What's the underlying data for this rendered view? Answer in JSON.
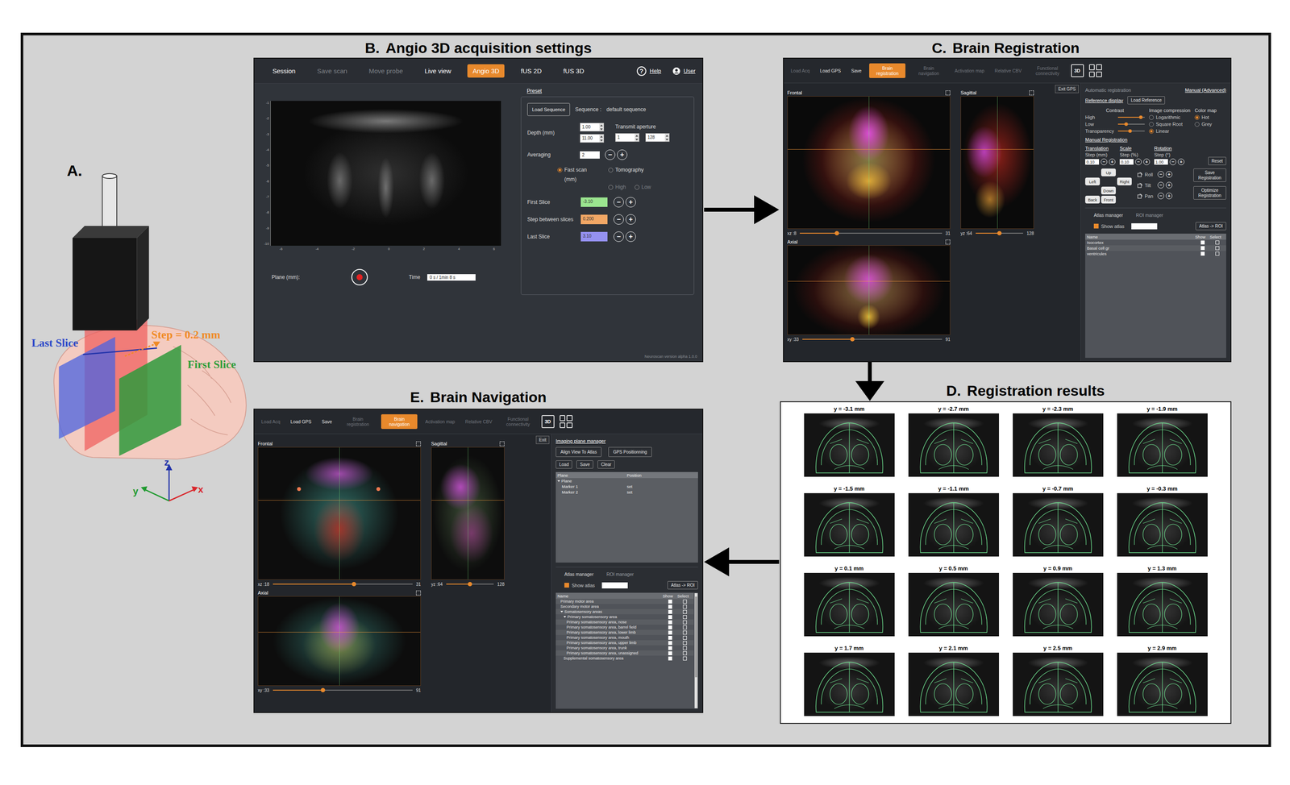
{
  "figure": {
    "panel_a": {
      "label": "A.",
      "last_slice": "Last Slice",
      "first_slice": "First Slice",
      "step": "Step = 0.2 mm",
      "axes": [
        {
          "label": "z"
        },
        {
          "label": "y"
        },
        {
          "label": "x"
        }
      ]
    },
    "panel_b": {
      "label": "B.",
      "title": "Angio 3D acquisition settings",
      "menu": [
        {
          "label": "Session",
          "disabled": false,
          "selected": false
        },
        {
          "label": "Save scan",
          "disabled": true,
          "selected": false
        },
        {
          "label": "Move probe",
          "disabled": true,
          "selected": false
        },
        {
          "label": "Live view",
          "disabled": false,
          "selected": false
        },
        {
          "label": "Angio 3D",
          "disabled": false,
          "selected": true
        },
        {
          "label": "fUS 2D",
          "disabled": false,
          "selected": false
        },
        {
          "label": "fUS 3D",
          "disabled": false,
          "selected": false
        }
      ],
      "help_icon": "?",
      "help": "Help",
      "user": "User",
      "y_ticks": [
        "-1",
        "-2",
        "-3",
        "-4",
        "-5",
        "-6",
        "-7",
        "-8",
        "-9",
        "-10"
      ],
      "x_ticks": [
        "-6",
        "-4",
        "-2",
        "0",
        "2",
        "4",
        "6"
      ],
      "plane_label": "Plane (mm):",
      "time_label": "Time",
      "time_value": "0 s / 1min 8 s",
      "preset": "Preset",
      "load_sequence": "Load Sequence",
      "sequence_label": "Sequence :",
      "sequence_value": "default sequence",
      "depth_label": "Depth (mm)",
      "depth_values": [
        "1.00",
        "11.00"
      ],
      "aperture_label": "Transmit aperture",
      "aperture_values": [
        "1",
        "128"
      ],
      "averaging_label": "Averaging",
      "averaging_value": "2",
      "modes": [
        {
          "label": "Fast scan",
          "selected": true
        },
        {
          "label": "Tomography",
          "selected": false
        }
      ],
      "unit": "(mm)",
      "tomo_options": [
        {
          "label": "High",
          "disabled": true,
          "selected": false
        },
        {
          "label": "Low",
          "disabled": true,
          "selected": false
        }
      ],
      "slices": [
        {
          "label": "First Slice",
          "value": "-3.10",
          "color": "#9be58f"
        },
        {
          "label": "Step between slices",
          "value": "0.200",
          "color": "#f2a765"
        },
        {
          "label": "Last Slice",
          "value": "3.10",
          "color": "#9591f0"
        }
      ],
      "version": "Neuroscan version alpha 1.0.0"
    },
    "panel_c": {
      "label": "C.",
      "title": "Brain Registration",
      "toolbar": [
        {
          "label": "Load Acq",
          "disabled": true,
          "selected": false
        },
        {
          "label": "Load GPS",
          "disabled": false,
          "selected": false
        },
        {
          "label": "Save",
          "disabled": false,
          "selected": false
        },
        {
          "label": "Brain registration",
          "disabled": false,
          "selected": true
        },
        {
          "label": "Brain navigation",
          "disabled": true,
          "selected": false
        },
        {
          "label": "Activation map",
          "disabled": true,
          "selected": false
        },
        {
          "label": "Relative CBV",
          "disabled": true,
          "selected": false
        },
        {
          "label": "Functional connectivity",
          "disabled": true,
          "selected": false
        }
      ],
      "view_3d": "3D",
      "exit": "Exit GPS",
      "views": [
        {
          "name": "Frontal",
          "slider_label": "xz :8",
          "max": "31",
          "level": 0.26
        },
        {
          "name": "Sagittal",
          "slider_label": "yz :64",
          "max": "128",
          "level": 0.5
        },
        {
          "name": "Axial",
          "slider_label": "xy :33",
          "max": "91",
          "level": 0.36
        }
      ],
      "modes": [
        {
          "label": "Automatic registration",
          "selected": false
        },
        {
          "label": "Manual (Advanced)",
          "selected": true
        }
      ],
      "reference_display": "Reference display",
      "load_reference": "Load Reference",
      "contrast": "Contrast",
      "contrast_sliders": [
        {
          "label": "High",
          "level": 0.85
        },
        {
          "label": "Low",
          "level": 0.3
        },
        {
          "label": "Transparency",
          "level": 0.45
        }
      ],
      "compression": {
        "label": "Image compression",
        "options": [
          {
            "label": "Logarithmic",
            "selected": false
          },
          {
            "label": "Square Root",
            "selected": false
          },
          {
            "label": "Linear",
            "selected": true
          }
        ]
      },
      "colormap": {
        "label": "Color map",
        "options": [
          {
            "label": "Hot",
            "selected": true
          },
          {
            "label": "Grey",
            "selected": false
          }
        ]
      },
      "manual_registration": "Manual Registration",
      "steps": [
        {
          "title": "Translation",
          "label": "Step (mm)",
          "value": "0.10"
        },
        {
          "title": "Scale",
          "label": "Step (%)",
          "value": "0.10"
        },
        {
          "title": "Rotation",
          "label": "Step (°)",
          "value": "1.00"
        }
      ],
      "reset": "Reset",
      "directions": {
        "up": "Up",
        "left": "Left",
        "right": "Right",
        "down": "Down",
        "back": "Back",
        "front": "Front"
      },
      "rotations": [
        "Roll",
        "Tilt",
        "Pan"
      ],
      "save_registration": "Save Registration",
      "optimize_registration": "Optimize Registration",
      "tabs": [
        {
          "label": "Atlas manager",
          "selected": true
        },
        {
          "label": "ROI manager",
          "selected": false
        }
      ],
      "show_atlas": {
        "label": "Show atlas",
        "checked": true
      },
      "atlas_roi": "Atlas -> ROI",
      "columns": [
        "Name",
        "Show",
        "Select"
      ],
      "rows": [
        {
          "name": "Isocortex",
          "show": true,
          "select": false
        },
        {
          "name": "Basal cell gr",
          "show": true,
          "select": false
        },
        {
          "name": "ventricules",
          "show": true,
          "select": false
        }
      ]
    },
    "panel_d": {
      "label": "D.",
      "title": "Registration results",
      "slices": [
        {
          "label": "y = -3.1 mm"
        },
        {
          "label": "y = -2.7 mm"
        },
        {
          "label": "y = -2.3 mm"
        },
        {
          "label": "y = -1.9 mm"
        },
        {
          "label": "y = -1.5 mm"
        },
        {
          "label": "y = -1.1 mm"
        },
        {
          "label": "y = -0.7 mm"
        },
        {
          "label": "y = -0.3 mm"
        },
        {
          "label": "y = 0.1 mm"
        },
        {
          "label": "y = 0.5 mm"
        },
        {
          "label": "y = 0.9 mm"
        },
        {
          "label": "y = 1.3 mm"
        },
        {
          "label": "y = 1.7 mm"
        },
        {
          "label": "y = 2.1 mm"
        },
        {
          "label": "y = 2.5 mm"
        },
        {
          "label": "y = 2.9 mm"
        }
      ]
    },
    "panel_e": {
      "label": "E.",
      "title": "Brain Navigation",
      "toolbar": [
        {
          "label": "Load Acq",
          "disabled": true,
          "selected": false
        },
        {
          "label": "Load GPS",
          "disabled": false,
          "selected": false
        },
        {
          "label": "Save",
          "disabled": false,
          "selected": false
        },
        {
          "label": "Brain registration",
          "disabled": true,
          "selected": false
        },
        {
          "label": "Brain navigation",
          "disabled": false,
          "selected": true
        },
        {
          "label": "Activation map",
          "disabled": true,
          "selected": false
        },
        {
          "label": "Relative CBV",
          "disabled": true,
          "selected": false
        },
        {
          "label": "Functional connectivity",
          "disabled": true,
          "selected": false
        }
      ],
      "view_3d": "3D",
      "exit": "Exit",
      "views": [
        {
          "name": "Frontal",
          "slider_label": "xz :18",
          "max": "31",
          "level": 0.58
        },
        {
          "name": "Sagittal",
          "slider_label": "yz :64",
          "max": "128",
          "level": 0.5
        },
        {
          "name": "Axial",
          "slider_label": "xy :33",
          "max": "91",
          "level": 0.36
        }
      ],
      "plane_manager": "Imaging plane manager",
      "align": "Align View To Atlas",
      "gps": "GPS Positionning",
      "file_buttons": [
        "Load",
        "Save",
        "Clear"
      ],
      "plane_columns": [
        "Plane",
        "Position"
      ],
      "plane_rows": [
        {
          "plane": "Plane",
          "position": "",
          "depth": 0,
          "parent": true,
          "expanded": true
        },
        {
          "plane": "Marker 1",
          "position": "set",
          "depth": 1,
          "parent": false,
          "expanded": false
        },
        {
          "plane": "Marker 2",
          "position": "set",
          "depth": 1,
          "parent": false,
          "expanded": false
        }
      ],
      "tabs": [
        {
          "label": "Atlas manager",
          "selected": true
        },
        {
          "label": "ROI manager",
          "selected": false
        }
      ],
      "show_atlas": {
        "label": "Show atlas",
        "checked": true
      },
      "atlas_roi": "Atlas -> ROI",
      "columns": [
        "Name",
        "Show",
        "Select"
      ],
      "tree": [
        {
          "name": "Primary motor area",
          "depth": 1,
          "parent": false,
          "expanded": false,
          "show": true,
          "select": false
        },
        {
          "name": "Secondary motor area",
          "depth": 1,
          "parent": false,
          "expanded": false,
          "show": true,
          "select": false
        },
        {
          "name": "Somatosensory areas",
          "depth": 1,
          "parent": true,
          "expanded": true,
          "show": true,
          "select": false
        },
        {
          "name": "Primary somatosensory area",
          "depth": 2,
          "parent": true,
          "expanded": true,
          "show": true,
          "select": false
        },
        {
          "name": "Primary somatosensory area, nose",
          "depth": 3,
          "parent": false,
          "expanded": false,
          "show": true,
          "select": false
        },
        {
          "name": "Primary somatosensory area, barrel field",
          "depth": 3,
          "parent": false,
          "expanded": false,
          "show": true,
          "select": false
        },
        {
          "name": "Primary somatosensory area, lower limb",
          "depth": 3,
          "parent": false,
          "expanded": false,
          "show": true,
          "select": false
        },
        {
          "name": "Primary somatosensory area, mouth",
          "depth": 3,
          "parent": false,
          "expanded": false,
          "show": true,
          "select": false
        },
        {
          "name": "Primary somatosensory area, upper limb",
          "depth": 3,
          "parent": false,
          "expanded": false,
          "show": true,
          "select": false
        },
        {
          "name": "Primary somatosensory area, trunk",
          "depth": 3,
          "parent": false,
          "expanded": false,
          "show": true,
          "select": false
        },
        {
          "name": "Primary somatosensory area, unassigned",
          "depth": 3,
          "parent": false,
          "expanded": false,
          "show": true,
          "select": false
        },
        {
          "name": "Supplemental somatosensory area",
          "depth": 2,
          "parent": false,
          "expanded": false,
          "show": true,
          "select": false
        }
      ]
    }
  },
  "glyphs": {
    "minus": "−",
    "plus": "+"
  }
}
